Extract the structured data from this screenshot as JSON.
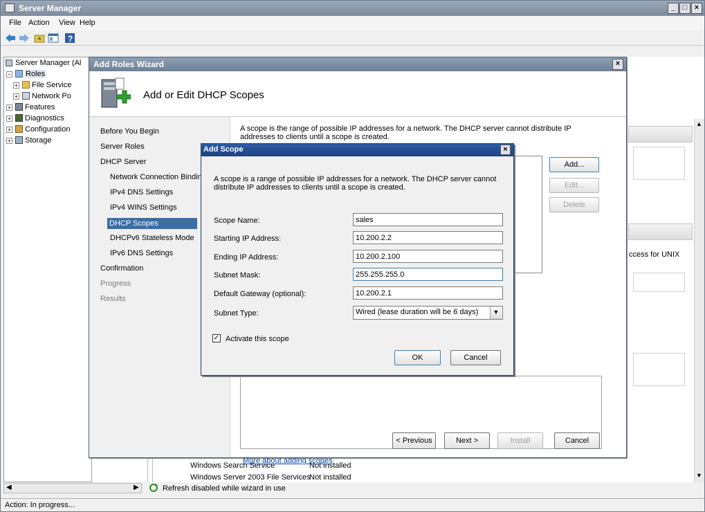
{
  "server_manager": {
    "title": "Server Manager",
    "menu": [
      "File",
      "Action",
      "View",
      "Help"
    ],
    "tree_root": "Server Manager (Al",
    "tree_items": [
      "Roles",
      "File Service",
      "Network Po",
      "Features",
      "Diagnostics",
      "Configuration",
      "Storage"
    ],
    "right_fragment": "ccess for UNIX",
    "bottom_rows": [
      {
        "name": "Windows Search Service",
        "status": "Not installed"
      },
      {
        "name": "Windows Server 2003 File Services",
        "status": "Not installed"
      }
    ],
    "refresh_text": "Refresh disabled while wizard in use",
    "status_text": "Action:  In progress..."
  },
  "wizard": {
    "title": "Add Roles Wizard",
    "heading": "Add or Edit DHCP Scopes",
    "nav": [
      {
        "label": "Before You Begin",
        "level": 0,
        "state": "normal"
      },
      {
        "label": "Server Roles",
        "level": 0,
        "state": "normal"
      },
      {
        "label": "DHCP Server",
        "level": 0,
        "state": "normal"
      },
      {
        "label": "Network Connection Binding",
        "level": 1,
        "state": "normal"
      },
      {
        "label": "IPv4 DNS Settings",
        "level": 1,
        "state": "normal"
      },
      {
        "label": "IPv4 WINS Settings",
        "level": 1,
        "state": "normal"
      },
      {
        "label": "DHCP Scopes",
        "level": 1,
        "state": "selected"
      },
      {
        "label": "DHCPv6 Stateless Mode",
        "level": 1,
        "state": "normal"
      },
      {
        "label": "IPv6 DNS Settings",
        "level": 1,
        "state": "normal"
      },
      {
        "label": "Confirmation",
        "level": 0,
        "state": "normal"
      },
      {
        "label": "Progress",
        "level": 0,
        "state": "disabled"
      },
      {
        "label": "Results",
        "level": 0,
        "state": "disabled"
      }
    ],
    "description": "A scope is the range of possible IP addresses for a network. The DHCP server cannot distribute IP addresses to clients until a scope is created.",
    "add_label": "Add...",
    "edit_label": "Edit...",
    "delete_label": "Delete",
    "more_link": "More about adding scopes",
    "prev_label": "< Previous",
    "next_label": "Next >",
    "install_label": "Install",
    "cancel_label": "Cancel"
  },
  "scope_dialog": {
    "title": "Add Scope",
    "description": "A scope is a range of possible IP addresses for a network. The DHCP server cannot distribute IP addresses to clients until a scope is created.",
    "fields": {
      "scope_name": {
        "label": "Scope Name:",
        "value": "sales"
      },
      "start_ip": {
        "label": "Starting IP Address:",
        "value": "10.200.2.2"
      },
      "end_ip": {
        "label": "Ending IP Address:",
        "value": "10.200.2.100"
      },
      "subnet_mask": {
        "label": "Subnet Mask:",
        "value": "255.255.255.0"
      },
      "gateway": {
        "label": "Default Gateway (optional):",
        "value": "10.200.2.1"
      },
      "subnet_type": {
        "label": "Subnet Type:",
        "value": "Wired (lease duration will be 6 days)"
      }
    },
    "activate_label": "Activate this scope",
    "activate_checked": "✓",
    "ok_label": "OK",
    "cancel_label": "Cancel"
  }
}
